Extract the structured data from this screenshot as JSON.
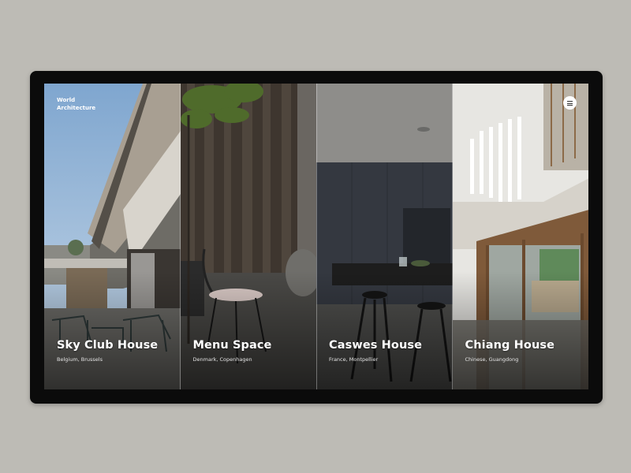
{
  "brand": {
    "line1": "World",
    "line2": "Architecture"
  },
  "menu": {
    "icon": "hamburger-menu-icon"
  },
  "panels": [
    {
      "title": "Sky Club House",
      "location": "Belgium, Brussels"
    },
    {
      "title": "Menu Space",
      "location": "Denmark, Copenhagen"
    },
    {
      "title": "Caswes House",
      "location": "France, Montpellier"
    },
    {
      "title": "Chiang House",
      "location": "Chinese, Guangdong"
    }
  ],
  "colors": {
    "background": "#bdbbb5",
    "device_frame": "#0b0b0b",
    "text": "#ffffff"
  }
}
